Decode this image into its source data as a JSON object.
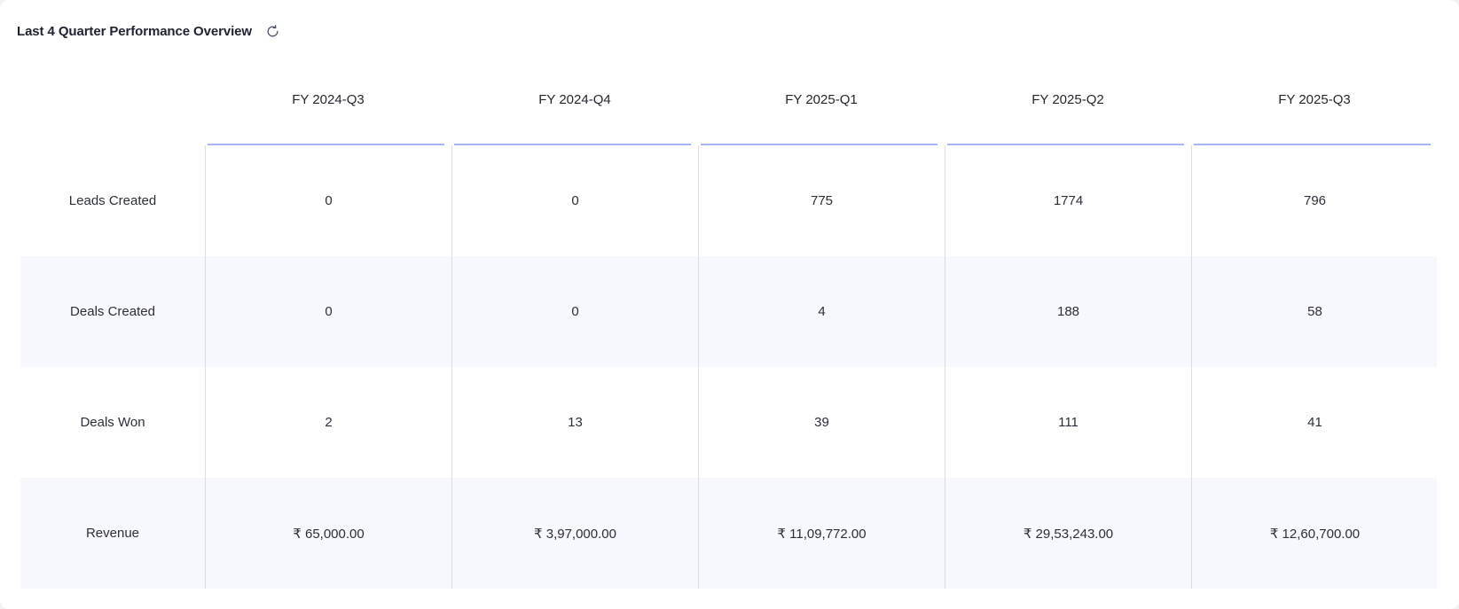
{
  "widget": {
    "title": "Last 4 Quarter Performance Overview",
    "refresh_icon": "refresh-icon"
  },
  "quarters": [
    "FY 2024-Q3",
    "FY 2024-Q4",
    "FY 2025-Q1",
    "FY 2025-Q2",
    "FY 2025-Q3"
  ],
  "rows": [
    {
      "label": "Leads Created",
      "values": [
        "0",
        "0",
        "775",
        "1774",
        "796"
      ]
    },
    {
      "label": "Deals Created",
      "values": [
        "0",
        "0",
        "4",
        "188",
        "58"
      ]
    },
    {
      "label": "Deals Won",
      "values": [
        "2",
        "13",
        "39",
        "111",
        "41"
      ]
    },
    {
      "label": "Revenue",
      "values": [
        "₹ 65,000.00",
        "₹ 3,97,000.00",
        "₹ 11,09,772.00",
        "₹ 29,53,243.00",
        "₹ 12,60,700.00"
      ]
    }
  ],
  "colors": {
    "header_underline": "#a9b5f5",
    "shaded_row": "#f7f8fd",
    "divider": "#dcdce4"
  }
}
